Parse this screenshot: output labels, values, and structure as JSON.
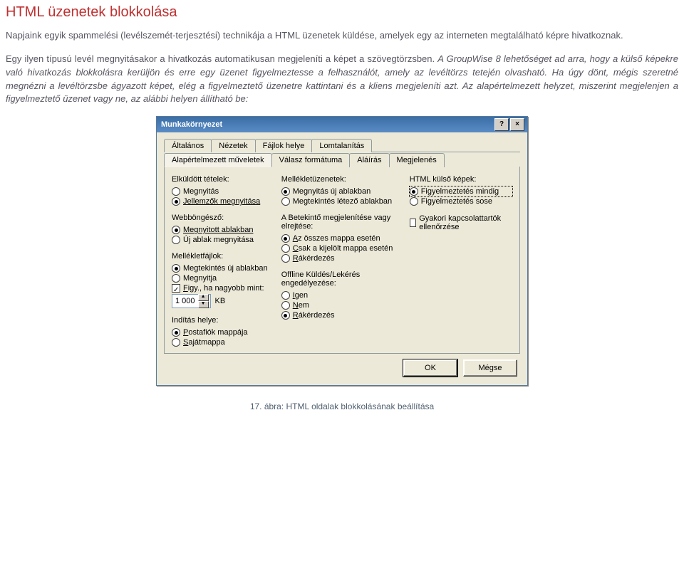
{
  "doc": {
    "title": "HTML üzenetek blokkolása",
    "para1": "Napjaink egyik spammelési (levélszemét-terjesztési) technikája a HTML üzenetek küldése, amelyek egy az interneten megtalálható képre hivatkoznak.",
    "para2": "Egy ilyen típusú levél megnyitásakor a hivatkozás automatikusan megjeleníti a képet a szövegtörzsben. ",
    "para2i": "A GroupWise 8 lehetőséget ad arra, hogy a külső képekre való hivatkozás blokkolásra kerüljön és erre egy üzenet figyelmeztesse a felhasználót, amely az levéltörzs tetején olvasható. Ha úgy dönt, mégis szeretné megnézni a levéltörzsbe ágyazott képet, elég a figyelmeztető üzenetre kattintani és a kliens megjeleníti azt. Az alapértelmezett helyzet, miszerint megjelenjen a figyelmeztető üzenet vagy ne, az alábbi helyen állítható be:",
    "caption": "17. ábra: HTML oldalak blokkolásának beállítása"
  },
  "dlg": {
    "title": "Munkakörnyezet",
    "help": "?",
    "close": "×",
    "tabs_row1": [
      "Általános",
      "Nézetek",
      "Fájlok helye",
      "Lomtalanítás"
    ],
    "tabs_row2": [
      "Alapértelmezett műveletek",
      "Válasz formátuma",
      "Aláírás",
      "Megjelenés"
    ],
    "col1": {
      "sent_label": "Elküldött tételek:",
      "sent_opts": [
        "Megnyitás",
        "Jellemzők megnyitása"
      ],
      "sent_sel": 1,
      "web_label": "Webböngésző:",
      "web_opts": [
        "Megnyitott ablakban",
        "Új ablak megnyitása"
      ],
      "web_sel": 0,
      "att_label": "Mellékletfájlok:",
      "att_opts": [
        "Megtekintés új ablakban",
        "Megnyitja"
      ],
      "att_sel": 0,
      "warn_chk_prefix": "F",
      "warn_chk_rest": "igy., ha nagyobb mint:",
      "warn_val": "1 000",
      "warn_unit": "KB",
      "start_label": "Indítás helye:",
      "start_opts_prefix": [
        "P",
        "S"
      ],
      "start_opts_rest": [
        "ostafiók mappája",
        "ajátmappa"
      ],
      "start_sel": 0
    },
    "col2": {
      "msgatt_label": "Mellékletüzenetek:",
      "msgatt_opts": [
        "Megnyitás új ablakban",
        "Megtekintés létező ablakban"
      ],
      "msgatt_sel": 0,
      "preview_label": "A Betekintő megjelenítése vagy elrejtése:",
      "preview_opts_prefix": [
        "A",
        "C",
        "R"
      ],
      "preview_opts_rest": [
        "z összes mappa esetén",
        "sak a kijelölt mappa esetén",
        "ákérdezés"
      ],
      "preview_sel": 0,
      "offline_label": "Offline Küldés/Lekérés engedélyezése:",
      "offline_opts_prefix": [
        "I",
        "N",
        "R"
      ],
      "offline_opts_rest": [
        "gen",
        "em",
        "ákérdezés"
      ],
      "offline_sel": 2
    },
    "col3": {
      "ext_label": "HTML külső képek:",
      "ext_opts": [
        "Figyelmeztetés mindig",
        "Figyelmeztetés sose"
      ],
      "ext_sel": 0,
      "freq_chk": "Gyakori kapcsolattartók ellenőrzése"
    },
    "ok": "OK",
    "cancel": "Mégse"
  }
}
